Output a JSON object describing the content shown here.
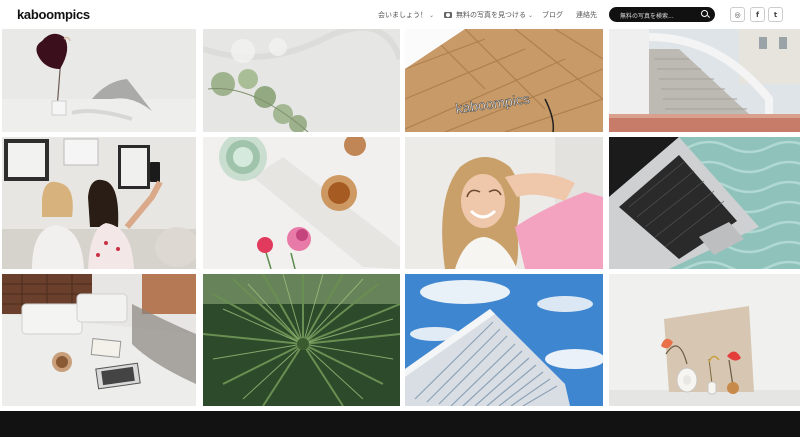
{
  "header": {
    "logo": "kaboompics",
    "nav": [
      {
        "label": "会いましょう！",
        "has_chevron": true
      },
      {
        "label": "無料の写真を見つける",
        "has_chevron": true,
        "icon": "camera-icon"
      },
      {
        "label": "ブログ",
        "has_chevron": false
      },
      {
        "label": "連絡先",
        "has_chevron": false
      }
    ],
    "search": {
      "placeholder": "無料の写真を検索..."
    },
    "social": [
      "instagram-icon",
      "facebook-icon",
      "twitter-icon"
    ]
  },
  "photos": [
    {
      "name": "photo-red-anthurium"
    },
    {
      "name": "photo-eucalyptus-marble"
    },
    {
      "name": "photo-kaboompics-neon-sign",
      "sign_text": "kaboompics"
    },
    {
      "name": "photo-palace-staircase"
    },
    {
      "name": "photo-girls-selfie"
    },
    {
      "name": "photo-glasses-flowers"
    },
    {
      "name": "photo-smiling-woman-pink"
    },
    {
      "name": "photo-laptop-knit"
    },
    {
      "name": "photo-bed-breakfast"
    },
    {
      "name": "photo-palm-leaves"
    },
    {
      "name": "photo-glass-building"
    },
    {
      "name": "photo-vases-flowers"
    }
  ],
  "colors": {
    "accent": "#111111",
    "footer": "#121212"
  }
}
